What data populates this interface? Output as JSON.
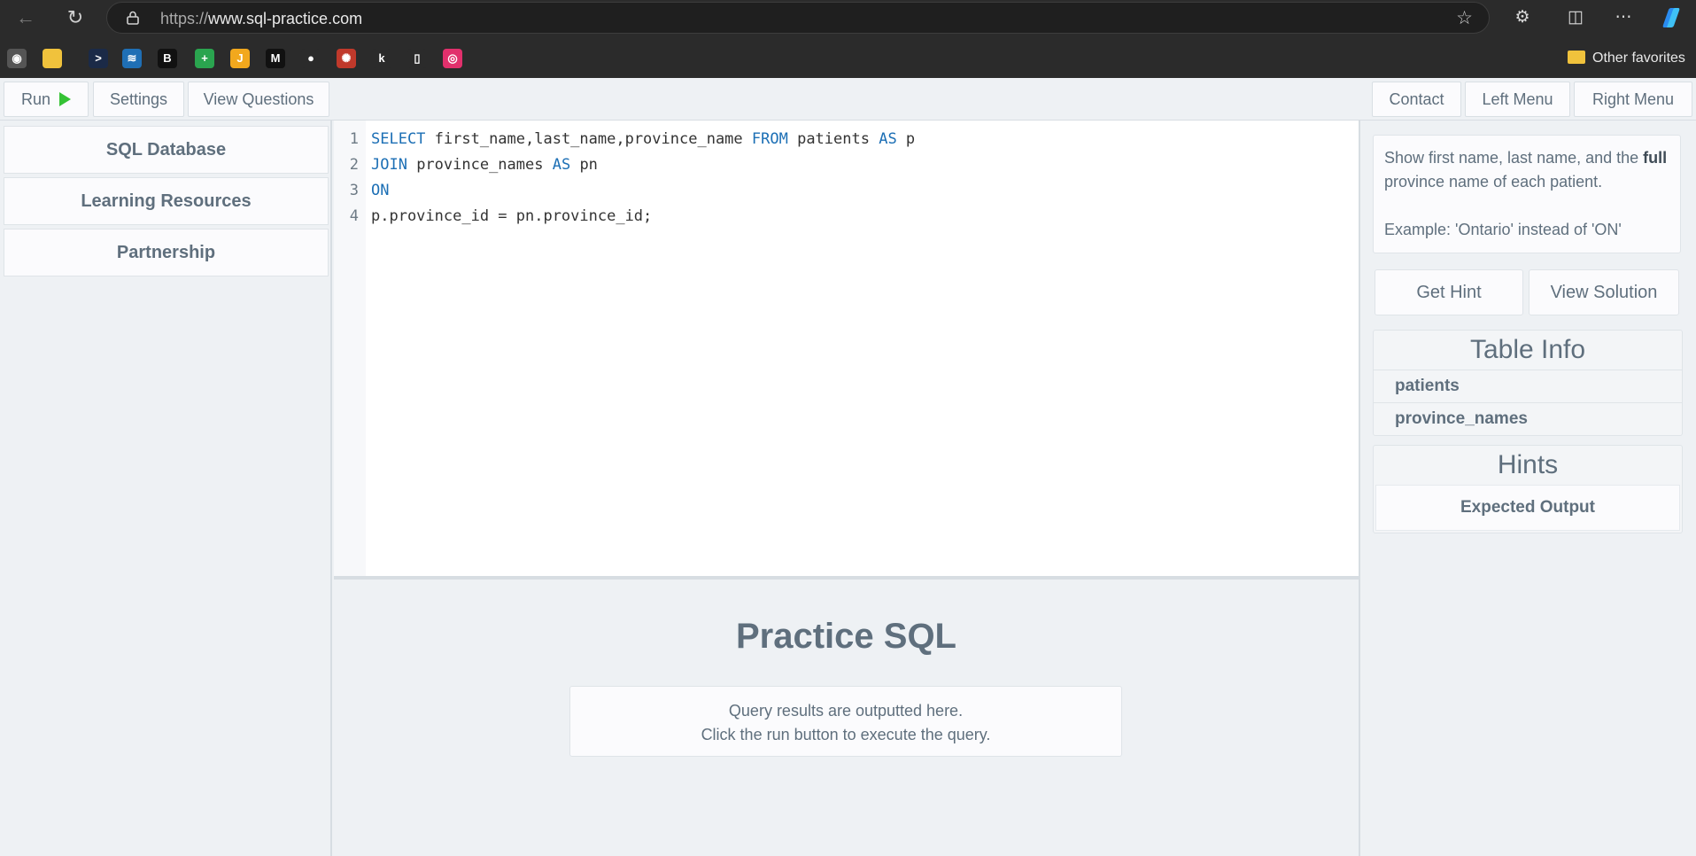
{
  "browser": {
    "url_scheme": "https://",
    "url_host": "www.sql-practice.com",
    "other_favorites": "Other favorites",
    "favorites": [
      {
        "name": "podcast",
        "glyph": "◉",
        "color": "#555555"
      },
      {
        "name": "folder",
        "glyph": "",
        "color": "#f0c23c"
      },
      {
        "name": "terminal",
        "glyph": ">",
        "color": "#1b2a47"
      },
      {
        "name": "layers",
        "glyph": "≋",
        "color": "#1f6fb5"
      },
      {
        "name": "b-logo",
        "glyph": "B",
        "color": "#111111"
      },
      {
        "name": "plus-square",
        "glyph": "+",
        "color": "#2aa44f"
      },
      {
        "name": "j-logo",
        "glyph": "J",
        "color": "#f2a81d"
      },
      {
        "name": "medium",
        "glyph": "M",
        "color": "#111111"
      },
      {
        "name": "github",
        "glyph": "●",
        "color": "#2b2b2b"
      },
      {
        "name": "dots",
        "glyph": "✺",
        "color": "#c0392b"
      },
      {
        "name": "k-logo",
        "glyph": "k",
        "color": "#2b2b2b"
      },
      {
        "name": "document",
        "glyph": "▯",
        "color": "#2b2b2b"
      },
      {
        "name": "instagram",
        "glyph": "◎",
        "color": "#e1306c"
      }
    ]
  },
  "toolbar": {
    "run_label": "Run",
    "settings_label": "Settings",
    "view_questions_label": "View Questions",
    "contact_label": "Contact",
    "left_menu_label": "Left Menu",
    "right_menu_label": "Right Menu"
  },
  "sidebar": {
    "items": [
      {
        "label": "SQL Database"
      },
      {
        "label": "Learning Resources"
      },
      {
        "label": "Partnership"
      }
    ]
  },
  "editor": {
    "line_numbers": [
      "1",
      "2",
      "3",
      "4"
    ],
    "line1": {
      "kw1": "SELECT",
      "t1": " first_name,last_name,province_name ",
      "kw2": "FROM",
      "t2": " patients ",
      "kw3": "AS",
      "t3": " p"
    },
    "line2": {
      "kw1": "JOIN",
      "t1": " province_names ",
      "kw2": "AS",
      "t2": " pn"
    },
    "line3": {
      "kw1": "ON"
    },
    "line4": {
      "t1": "p.province_id = pn.province_id;"
    }
  },
  "results": {
    "title": "Practice SQL",
    "line1": "Query results are outputted here.",
    "line2": "Click the run button to execute the query."
  },
  "question": {
    "part1": "Show first name, last name, and the",
    "bold": "full",
    "part2": " province name of each patient.",
    "example": "Example: 'Ontario' instead of 'ON'"
  },
  "actions": {
    "get_hint_label": "Get Hint",
    "view_solution_label": "View Solution"
  },
  "table_info": {
    "title": "Table Info",
    "tables": [
      "patients",
      "province_names"
    ]
  },
  "hints": {
    "title": "Hints",
    "expected_output_label": "Expected Output"
  }
}
